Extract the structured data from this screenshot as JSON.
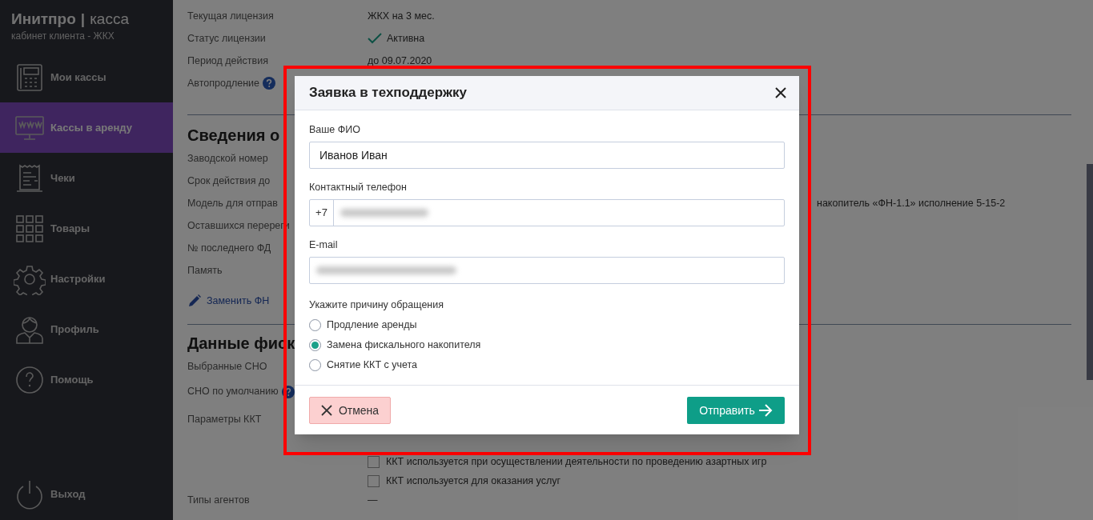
{
  "sidebar": {
    "brand": "Инитпро",
    "separator": "|",
    "product": "касса",
    "subtitle": "кабинет клиента - ЖКХ",
    "items": [
      {
        "label": "Мои кассы",
        "selected": false
      },
      {
        "label": "Кассы в аренду",
        "selected": true
      },
      {
        "label": "Чеки",
        "selected": false
      },
      {
        "label": "Товары",
        "selected": false
      },
      {
        "label": "Настройки",
        "selected": false
      },
      {
        "label": "Профиль",
        "selected": false
      },
      {
        "label": "Помощь",
        "selected": false
      }
    ],
    "exit": "Выход"
  },
  "license": [
    {
      "label": "Текущая лицензия",
      "value": "ЖКХ на 3 мес."
    },
    {
      "label": "Статус лицензии",
      "value": "Активна",
      "kind": "status"
    },
    {
      "label": "Период действия",
      "value": "до 09.07.2020"
    },
    {
      "label": "Автопродление",
      "kind": "help"
    }
  ],
  "fn_section": {
    "title": "Сведения о",
    "rows": [
      {
        "label": "Заводской номер"
      },
      {
        "label": "Срок действия до"
      },
      {
        "label": "Модель для отправ",
        "value": "накопитель «ФН-1.1» исполнение 5-15-2"
      },
      {
        "label": "Оставшихся перереги"
      },
      {
        "label": "№ последнего ФД"
      },
      {
        "label": "Память"
      }
    ],
    "link": "Заменить ФН"
  },
  "fiscal_section": {
    "title": "Данные фиск",
    "rows": [
      {
        "label": "Выбранные СНО"
      },
      {
        "label": "СНО по умолчанию",
        "kind": "help"
      },
      {
        "label": "Параметры ККТ"
      }
    ],
    "options": [
      {
        "label": "ККТ используется при осуществлении деятельности по проведению азартных игр",
        "checked": false
      },
      {
        "label": "ККТ используется для оказания услуг",
        "checked": false
      }
    ],
    "agents_label": "Типы агентов",
    "agents_value": "—"
  },
  "dialog": {
    "title": "Заявка в техподдержку",
    "fields": [
      {
        "label": "Ваше ФИО",
        "value": "Иванов Иван"
      },
      {
        "label": "Контактный телефон",
        "prefix": "+7",
        "redacted": true
      },
      {
        "label": "E-mail",
        "redacted": true
      }
    ],
    "reason_label": "Укажите причину обращения",
    "reasons": [
      {
        "label": "Продление аренды",
        "selected": false
      },
      {
        "label": "Замена фискального накопителя",
        "selected": true
      },
      {
        "label": "Снятие ККТ с учета",
        "selected": false
      }
    ],
    "cancel": "Отмена",
    "submit": "Отправить"
  }
}
